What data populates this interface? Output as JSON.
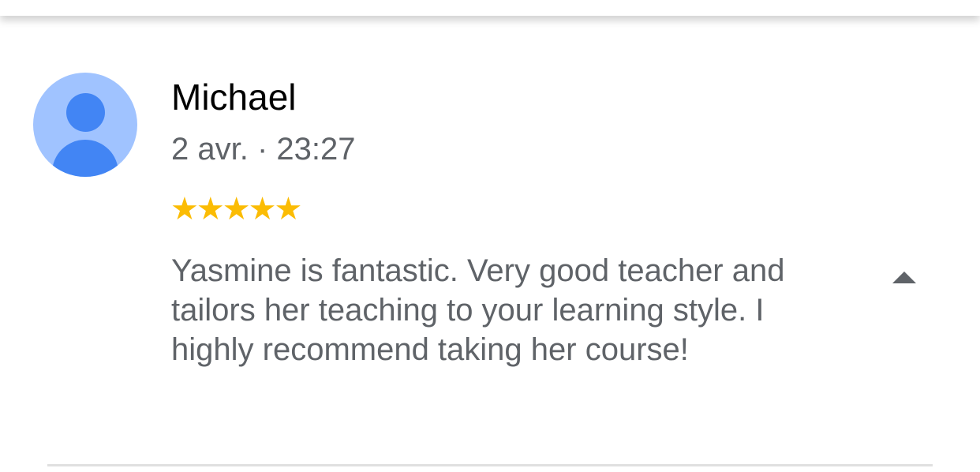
{
  "review": {
    "reviewer_name": "Michael",
    "date_time": "2 avr. · 23:27",
    "rating": 5,
    "rating_max": 5,
    "stars_text": "★★★★★",
    "text": "Yasmine is fantastic. Very good teacher and tailors her teaching to your learning style. I highly recommend taking her course!",
    "avatar_icon": "default-person-avatar-icon",
    "toggle_icon": "collapse-up-triangle-icon"
  },
  "colors": {
    "star": "#fbbc04",
    "avatar_bg": "#a0c3ff",
    "avatar_fg": "#4285f4",
    "secondary_text": "#5f6368",
    "name_text": "#000000",
    "divider": "#e0e0e0"
  }
}
